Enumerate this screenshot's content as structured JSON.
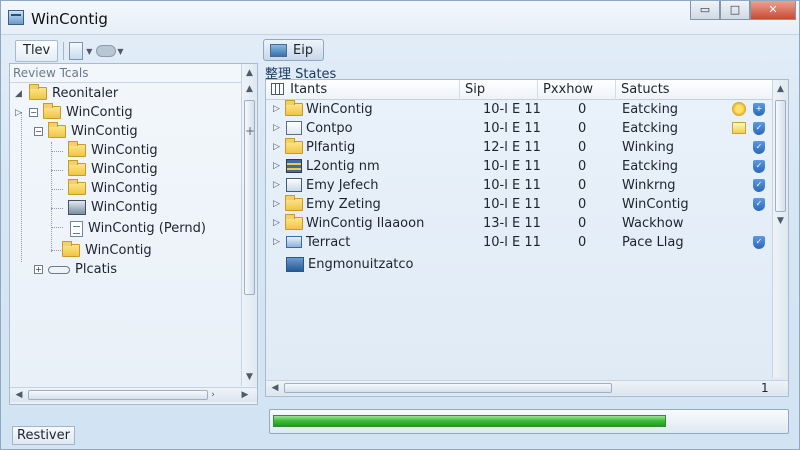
{
  "window": {
    "title": "WinContig",
    "controls": {
      "minimize": "▭",
      "maximize": "□",
      "close": "✕"
    }
  },
  "left_toolbar": {
    "view_label": "Tlev"
  },
  "right_toolbar": {
    "button_label": "Eip"
  },
  "left_pane": {
    "header": "Review Tcals",
    "tree": [
      {
        "label": "Reonitaler"
      },
      {
        "label": "WinContig"
      },
      {
        "label": "WinContig"
      },
      {
        "label": "WinContig"
      },
      {
        "label": "WinContig"
      },
      {
        "label": "WinContig"
      },
      {
        "label": "WinContig"
      },
      {
        "label": "WinContig (Pernd)"
      },
      {
        "label": "WinContig"
      },
      {
        "label": "Plcatis"
      }
    ],
    "status_label": "Restiver"
  },
  "right_pane": {
    "section_title": "整理 States",
    "columns": [
      "Itants",
      "Sip",
      "Pxxhow",
      "Satucts"
    ],
    "rows": [
      {
        "name": "WinContig",
        "size": "10-l E 11",
        "count": "0",
        "status": "Eatcking",
        "icon": "folder",
        "badge": "sun"
      },
      {
        "name": "Contpo",
        "size": "10-l E 11",
        "count": "0",
        "status": "Eatcking",
        "icon": "document",
        "badge": "note"
      },
      {
        "name": "Plfantig",
        "size": "12-l E 11",
        "count": "0",
        "status": "Winking",
        "icon": "folder",
        "badge": ""
      },
      {
        "name": "L2ontig nm",
        "size": "10-l E 11",
        "count": "0",
        "status": "Eatcking",
        "icon": "grid",
        "badge": ""
      },
      {
        "name": "Emy Jefech",
        "size": "10-l E 11",
        "count": "0",
        "status": "Winkrng",
        "icon": "monitor",
        "badge": ""
      },
      {
        "name": "Emy Zeting",
        "size": "10-l E 11",
        "count": "0",
        "status": "WinContig",
        "icon": "folder",
        "badge": ""
      },
      {
        "name": "WinContig Ilaaoon",
        "size": "13-l E 11",
        "count": "0",
        "status": "Wackhow",
        "icon": "folder",
        "badge": ""
      },
      {
        "name": "Terract",
        "size": "10-l E 11",
        "count": "0",
        "status": "Pace Llag",
        "icon": "mail",
        "badge": ""
      },
      {
        "name": "Engmonuitzatco",
        "size": "",
        "count": "",
        "status": "",
        "icon": "blue-box",
        "badge": ""
      }
    ],
    "page_indicator": "1"
  },
  "progress": {
    "fraction": 0.77
  },
  "colors": {
    "progress_green": "#3fbf3b",
    "shield_blue": "#2a67b8",
    "folder_yellow": "#eec545"
  }
}
